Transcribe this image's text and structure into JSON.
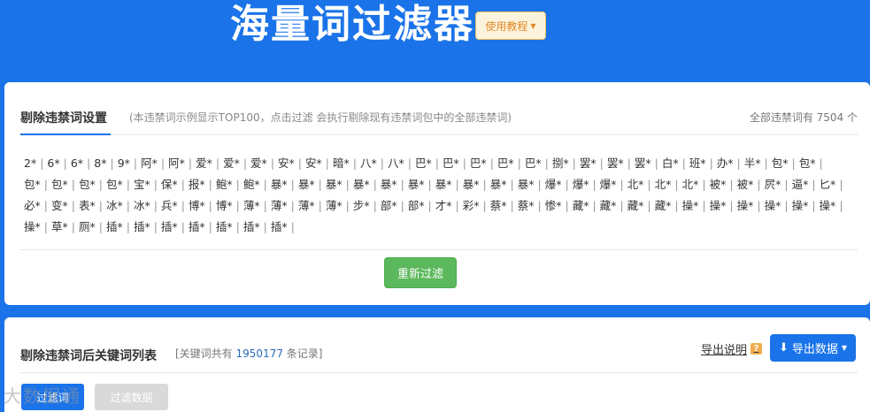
{
  "header": {
    "title": "海量词过滤器",
    "tutorial_label": "使用教程"
  },
  "banned_settings": {
    "tab_label": "剔除违禁词设置",
    "hint": "(本违禁词示例显示TOP100，点击过滤 会执行剔除现有违禁词包中的全部违禁词)",
    "total_count": "全部违禁词有 7504 个",
    "words": [
      "2*",
      "6*",
      "6*",
      "8*",
      "9*",
      "阿*",
      "阿*",
      "爱*",
      "爱*",
      "爱*",
      "安*",
      "安*",
      "暗*",
      "八*",
      "八*",
      "巴*",
      "巴*",
      "巴*",
      "巴*",
      "巴*",
      "捌*",
      "罢*",
      "罢*",
      "罢*",
      "白*",
      "班*",
      "办*",
      "半*",
      "包*",
      "包*",
      "包*",
      "包*",
      "包*",
      "包*",
      "宝*",
      "保*",
      "报*",
      "鲍*",
      "鲍*",
      "暴*",
      "暴*",
      "暴*",
      "暴*",
      "暴*",
      "暴*",
      "暴*",
      "暴*",
      "暴*",
      "暴*",
      "爆*",
      "爆*",
      "爆*",
      "北*",
      "北*",
      "北*",
      "被*",
      "被*",
      "屄*",
      "逼*",
      "匕*",
      "必*",
      "变*",
      "表*",
      "冰*",
      "冰*",
      "兵*",
      "博*",
      "博*",
      "薄*",
      "薄*",
      "薄*",
      "薄*",
      "步*",
      "部*",
      "部*",
      "才*",
      "彩*",
      "蔡*",
      "蔡*",
      "惨*",
      "藏*",
      "藏*",
      "藏*",
      "藏*",
      "操*",
      "操*",
      "操*",
      "操*",
      "操*",
      "操*",
      "操*",
      "草*",
      "厕*",
      "插*",
      "插*",
      "插*",
      "插*",
      "插*",
      "插*",
      "插*"
    ],
    "refilter_label": "重新过滤"
  },
  "keyword_list": {
    "title": "剔除违禁词后关键词列表",
    "meta_prefix": "[关键词共有",
    "meta_count": "1950177",
    "meta_suffix": "条记录]",
    "export_help_label": "导出说明",
    "export_label": "导出数据",
    "tab_keywords": "过滤词",
    "tab_filtered": "过滤数据"
  },
  "watermark": "大数据通",
  "colors": {
    "brand_blue": "#1a73e8",
    "success_green": "#5cb85c",
    "tutorial_orange": "#e0892b"
  }
}
